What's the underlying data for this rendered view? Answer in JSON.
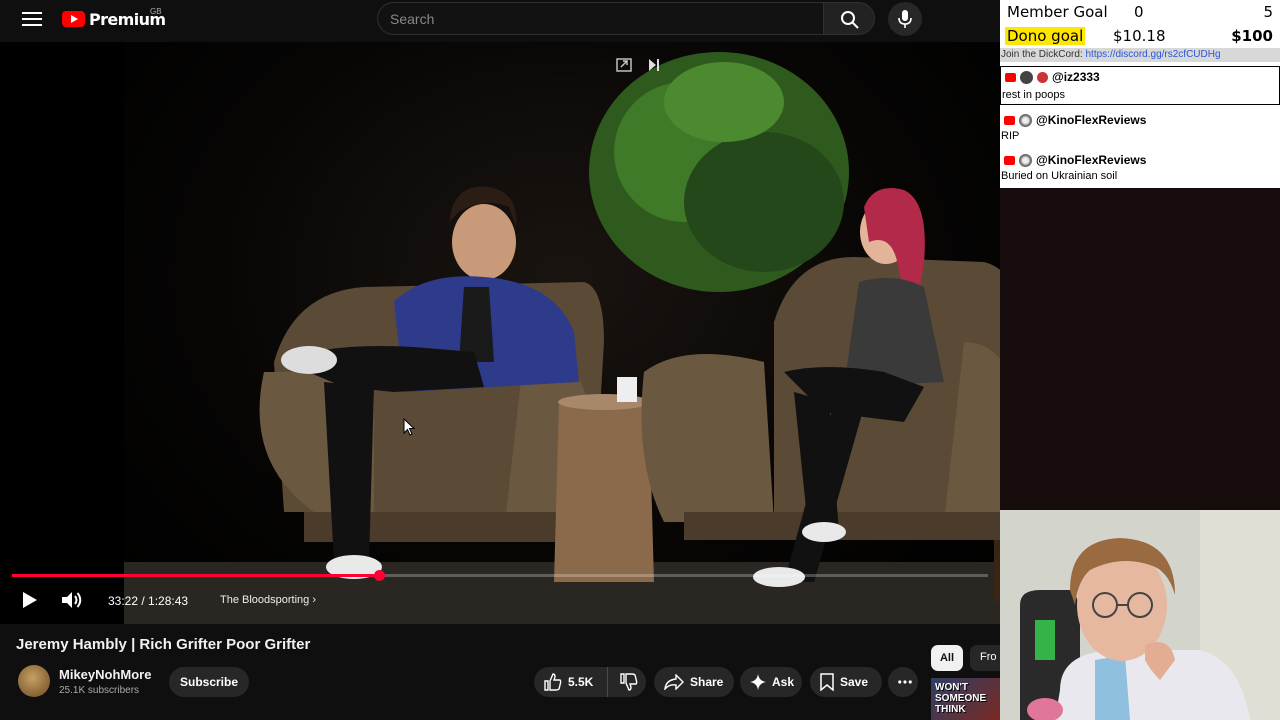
{
  "header": {
    "logo_text": "Premium",
    "logo_region": "GB",
    "search_placeholder": "Search"
  },
  "player": {
    "current_time": "33:22",
    "duration": "1:28:43",
    "time_display": "33:22 / 1:28:43",
    "chapter": "The Bloodsporting",
    "progress_fraction": 0.376
  },
  "video": {
    "title": "Jeremy Hambly | Rich Grifter Poor Grifter",
    "channel": "MikeyNohMore",
    "subscribers": "25.1K subscribers",
    "subscribe_label": "Subscribe",
    "likes": "5.5K",
    "share_label": "Share",
    "ask_label": "Ask",
    "save_label": "Save"
  },
  "chips": {
    "all": "All",
    "from": "Fro"
  },
  "related_thumb_text": "WON'T SOMEONE THINK",
  "overlay": {
    "member_goal_label": "Member Goal",
    "member_goal_current": "0",
    "member_goal_target": "5",
    "dono_goal_label": "Dono goal",
    "dono_current": "$10.18",
    "dono_target": "$100",
    "discord_prefix": "Join the DickCord: ",
    "discord_link": "https://discord.gg/rs2cfCUDHg"
  },
  "chat": [
    {
      "user": "@iz2333",
      "message": "rest in poops"
    },
    {
      "user": "@KinoFlexReviews",
      "message": "RIP"
    },
    {
      "user": "@KinoFlexReviews",
      "message": "Buried on Ukrainian soil"
    }
  ],
  "colors": {
    "accent": "#ff0033",
    "brand": "#ff0000",
    "dono_highlight": "#ffe600"
  }
}
